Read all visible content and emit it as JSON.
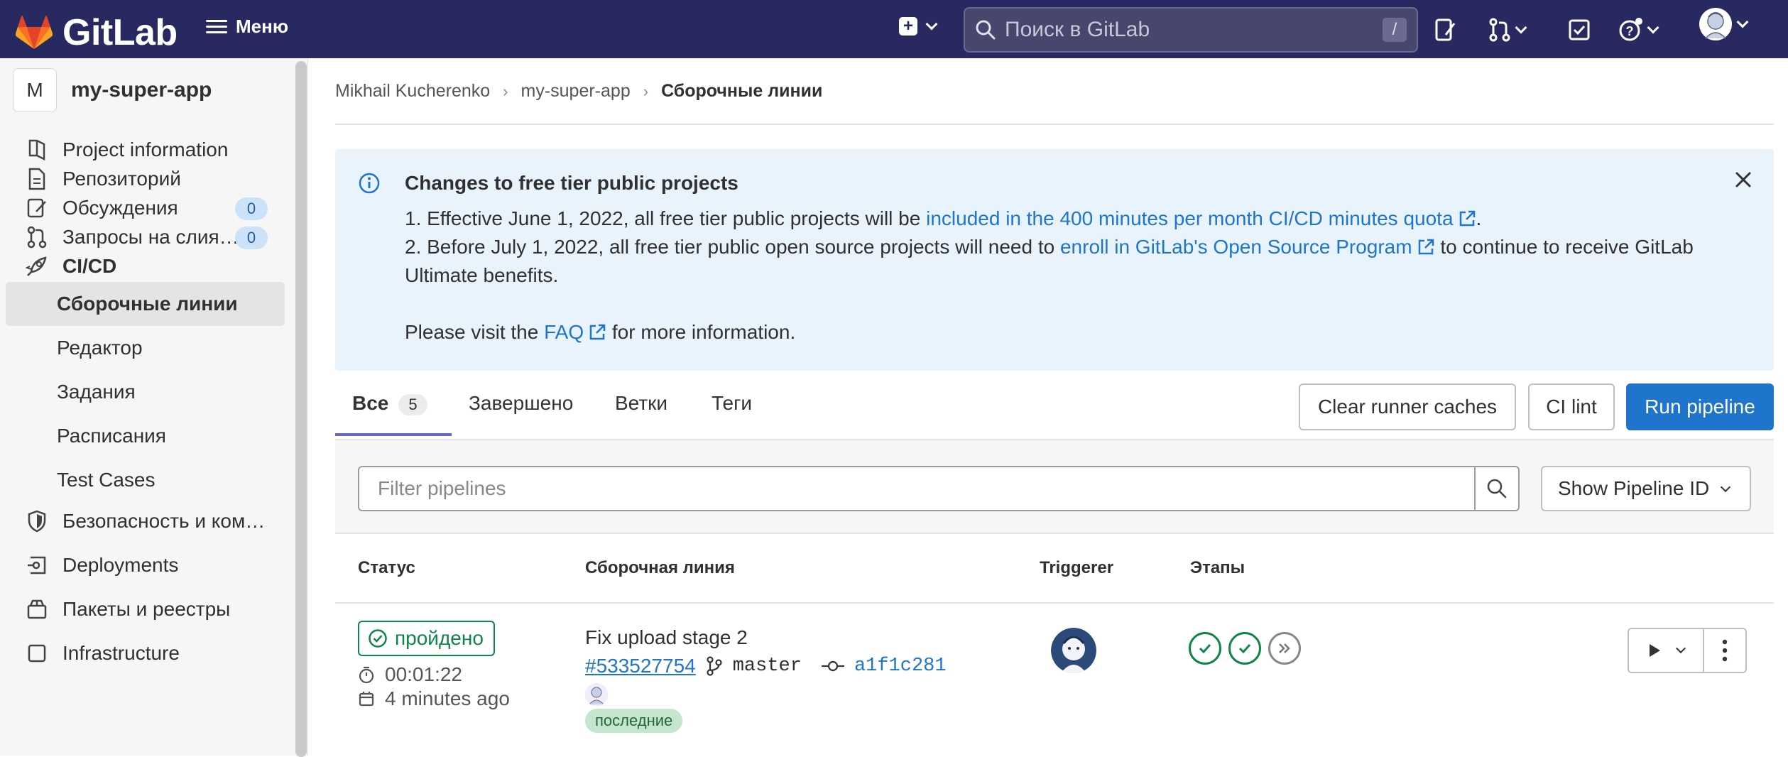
{
  "topbar": {
    "logo_text": "GitLab",
    "menu_label": "Меню",
    "search_placeholder": "Поиск в GitLab",
    "search_shortcut": "/"
  },
  "sidebar": {
    "project_initial": "M",
    "project_name": "my-super-app",
    "items": [
      {
        "label": "Project information",
        "icon": "info-doc-icon"
      },
      {
        "label": "Репозиторий",
        "icon": "doc-icon"
      },
      {
        "label": "Обсуждения",
        "icon": "issues-icon",
        "badge": "0"
      },
      {
        "label": "Запросы на слия…",
        "icon": "merge-request-icon",
        "badge": "0"
      },
      {
        "label": "CI/CD",
        "icon": "rocket-icon"
      },
      {
        "label": "Сборочные линии"
      },
      {
        "label": "Редактор"
      },
      {
        "label": "Задания"
      },
      {
        "label": "Расписания"
      },
      {
        "label": "Test Cases"
      },
      {
        "label": "Безопасность и ком…",
        "icon": "shield-icon"
      },
      {
        "label": "Deployments",
        "icon": "deployments-icon"
      },
      {
        "label": "Пакеты и реестры",
        "icon": "package-icon"
      },
      {
        "label": "Infrastructure",
        "icon": "infrastructure-icon"
      }
    ]
  },
  "breadcrumb": {
    "items": [
      "Mikhail Kucherenko",
      "my-super-app",
      "Сборочные линии"
    ]
  },
  "alert": {
    "title": "Changes to free tier public projects",
    "line1_prefix": "1. Effective June 1, 2022, all free tier public projects will be ",
    "line1_link": "included in the 400 minutes per month CI/CD minutes quota",
    "line1_suffix": ".",
    "line2_prefix": "2. Before July 1, 2022, all free tier public open source projects will need to ",
    "line2_link": "enroll in GitLab's Open Source Program",
    "line2_suffix": " to continue to receive GitLab Ultimate benefits.",
    "line3_prefix": "Please visit the ",
    "line3_link": "FAQ",
    "line3_suffix": " for more information."
  },
  "tabs": [
    {
      "label": "Все",
      "count": "5",
      "active": true
    },
    {
      "label": "Завершено"
    },
    {
      "label": "Ветки"
    },
    {
      "label": "Теги"
    }
  ],
  "actions": {
    "clear_caches": "Clear runner caches",
    "ci_lint": "CI lint",
    "run_pipeline": "Run pipeline"
  },
  "filter": {
    "placeholder": "Filter pipelines",
    "id_select": "Show Pipeline ID"
  },
  "table": {
    "headers": [
      "Статус",
      "Сборочная линия",
      "Triggerer",
      "Этапы"
    ],
    "rows": [
      {
        "status": "пройдено",
        "duration": "00:01:22",
        "finished": "4 minutes ago",
        "title": "Fix upload stage 2",
        "pipeline_id": "#533527754",
        "branch": "master",
        "commit": "a1f1c281",
        "tag": "последние",
        "stages": [
          "passed",
          "passed",
          "skipped"
        ]
      }
    ]
  },
  "colors": {
    "navbar": "#292961",
    "link": "#1f75cb",
    "success": "#108548",
    "alert_bg": "#e9f3fc",
    "primary_button": "#1f75cb"
  }
}
